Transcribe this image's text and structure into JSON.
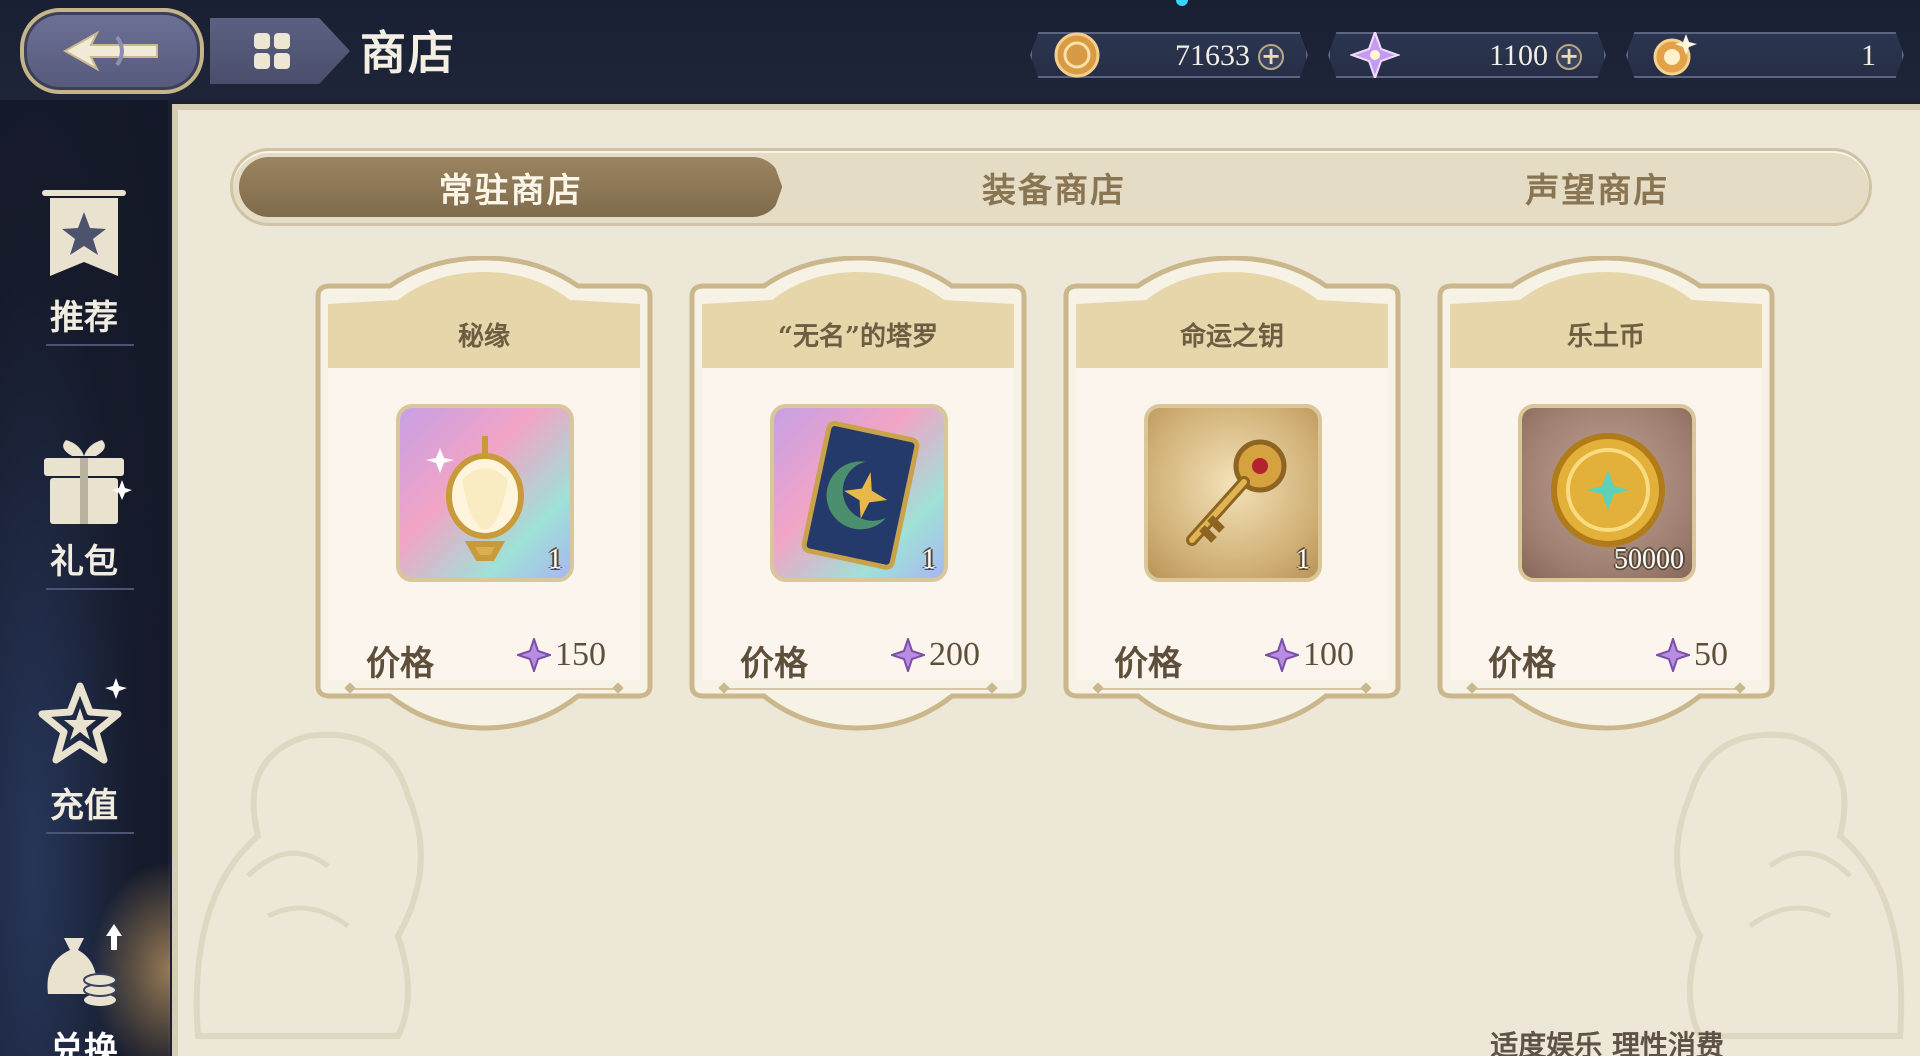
{
  "header": {
    "title": "商店",
    "currencies": [
      {
        "name": "coin",
        "icon": "gold-coin-icon",
        "amount": "71633",
        "has_plus": true
      },
      {
        "name": "star-gem",
        "icon": "star-gem-icon",
        "amount": "1100",
        "has_plus": true
      },
      {
        "name": "wish-token",
        "icon": "wish-token-icon",
        "amount": "1",
        "has_plus": false
      }
    ]
  },
  "sidebar": {
    "items": [
      {
        "label": "推荐",
        "icon": "star-banner-icon"
      },
      {
        "label": "礼包",
        "icon": "gift-box-icon"
      },
      {
        "label": "充值",
        "icon": "star-topup-icon"
      },
      {
        "label": "兑换",
        "icon": "money-bag-exchange-icon",
        "active": true
      }
    ]
  },
  "tabs": [
    {
      "label": "常驻商店",
      "active": true
    },
    {
      "label": "装备商店",
      "active": false
    },
    {
      "label": "声望商店",
      "active": false
    }
  ],
  "products": [
    {
      "name": "秘缘",
      "qty": "1",
      "price_label": "价格",
      "price": "150",
      "icon": "lantern-flower-icon",
      "bg": "rainbow"
    },
    {
      "name": "“无名”的塔罗",
      "qty": "1",
      "price_label": "价格",
      "price": "200",
      "icon": "tarot-card-icon",
      "bg": "rainbow"
    },
    {
      "name": "命运之钥",
      "qty": "1",
      "price_label": "价格",
      "price": "100",
      "icon": "golden-key-icon",
      "bg": "gold"
    },
    {
      "name": "乐土币",
      "qty": "50000",
      "price_label": "价格",
      "price": "50",
      "icon": "gold-coin-icon",
      "bg": "brown"
    }
  ],
  "footer": {
    "note": "适度娱乐 理性消费"
  },
  "colors": {
    "accent": "#7f6b4c",
    "panel": "#ece7d6",
    "dark": "#1b2133"
  }
}
